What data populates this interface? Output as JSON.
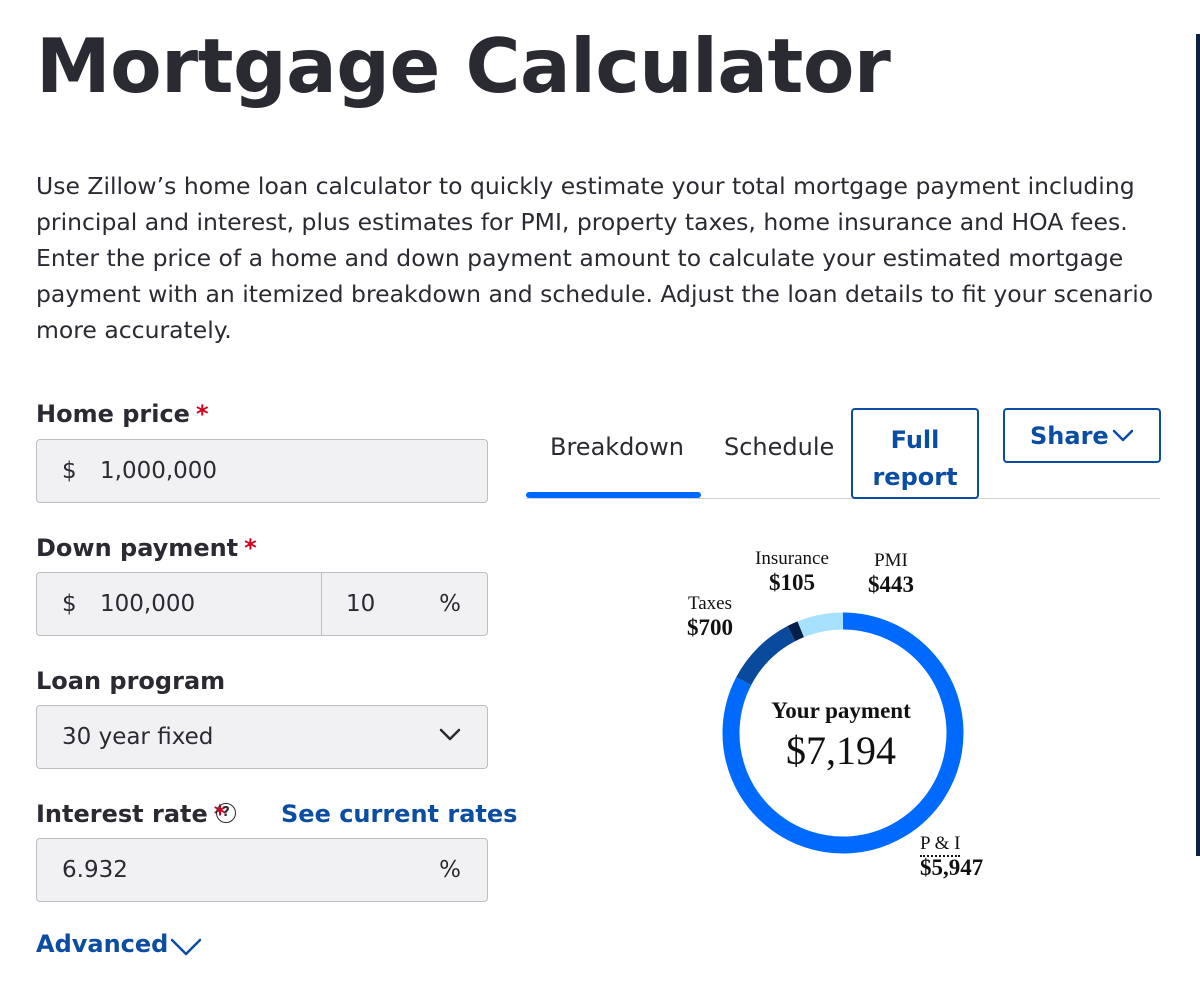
{
  "page": {
    "title": "Mortgage Calculator",
    "intro": "Use Zillow’s home loan calculator to quickly estimate your total mortgage payment including principal and interest, plus estimates for PMI, property taxes, home insurance and HOA fees. Enter the price of a home and down payment amount to calculate your estimated mortgage payment with an itemized breakdown and schedule. Adjust the loan details to fit your scenario more accurately."
  },
  "form": {
    "required_mark": "*",
    "home_price": {
      "label": "Home price",
      "prefix": "$",
      "value": "1,000,000"
    },
    "down_payment": {
      "label": "Down payment",
      "prefix": "$",
      "value": "100,000",
      "percent": "10",
      "percent_symbol": "%"
    },
    "loan_program": {
      "label": "Loan program",
      "value": "30 year fixed",
      "icon": "chevron-down-icon"
    },
    "interest_rate": {
      "label": "Interest rate",
      "help": "?",
      "link": "See current rates",
      "value": "6.932",
      "suffix": "%"
    },
    "advanced": {
      "label": "Advanced",
      "icon": "chevron-down-icon"
    }
  },
  "results": {
    "tabs": [
      {
        "label": "Breakdown",
        "active": true
      },
      {
        "label": "Schedule",
        "active": false
      }
    ],
    "full_report_line1": "Full",
    "full_report_line2": "report",
    "share_label": "Share",
    "payment_title": "Your payment",
    "payment_total": "$7,194",
    "breakdown": [
      {
        "name": "P & I",
        "amount": "$5,947",
        "value": 5947,
        "color": "#006aff"
      },
      {
        "name": "Taxes",
        "amount": "$700",
        "value": 700,
        "color": "#0a4a9c"
      },
      {
        "name": "Insurance",
        "amount": "$105",
        "value": 105,
        "color": "#061f4a"
      },
      {
        "name": "PMI",
        "amount": "$443",
        "value": 443,
        "color": "#a6e1fd"
      }
    ]
  },
  "colors": {
    "accent": "#006aff",
    "link": "#0b4da2",
    "required": "#d1001f",
    "text": "#2a2a33"
  }
}
